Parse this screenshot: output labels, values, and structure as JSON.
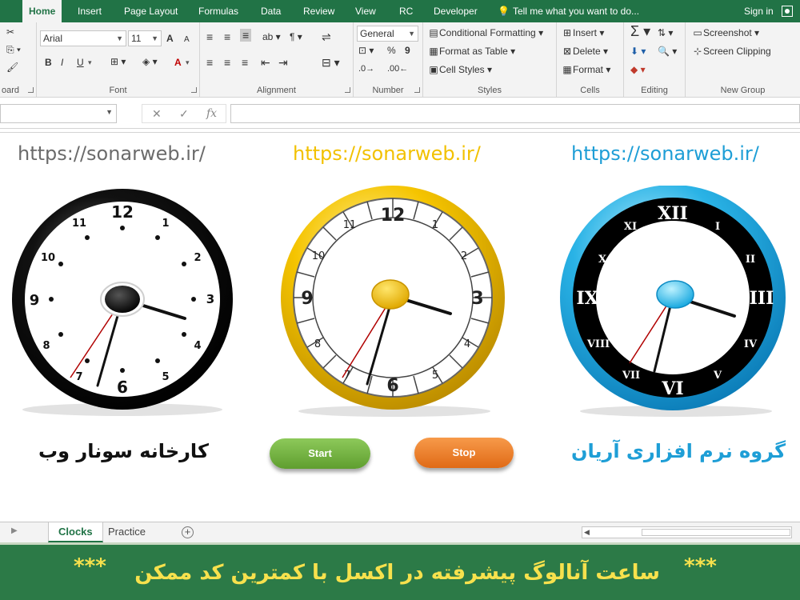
{
  "ribbon_tabs": {
    "home": "Home",
    "insert": "Insert",
    "page_layout": "Page Layout",
    "formulas": "Formulas",
    "data": "Data",
    "review": "Review",
    "view": "View",
    "rc": "RC",
    "developer": "Developer",
    "tell_me": "Tell me what you want to do...",
    "sign_in": "Sign in"
  },
  "ribbon": {
    "clipboard_label": "oard",
    "font": {
      "name": "Arial",
      "size": "11",
      "label": "Font",
      "bold": "B",
      "italic": "I",
      "underline": "U",
      "grow": "A",
      "shrink": "A",
      "font_color": "A"
    },
    "alignment_label": "Alignment",
    "number": {
      "format": "General",
      "percent": "%",
      "comma": "9",
      "label": "Number"
    },
    "styles": {
      "conditional": "Conditional Formatting",
      "table": "Format as Table",
      "cell": "Cell Styles",
      "label": "Styles"
    },
    "cells": {
      "insert": "Insert",
      "delete": "Delete",
      "format": "Format",
      "label": "Cells"
    },
    "editing_label": "Editing",
    "new_group": {
      "screenshot": "Screenshot",
      "clipping": "Screen Clipping",
      "label": "New Group"
    }
  },
  "formula_bar": {
    "name_box": "",
    "cancel": "✕",
    "enter": "✓",
    "fx": "fx",
    "formula": ""
  },
  "sheet": {
    "urls": [
      "https://sonarweb.ir/",
      "https://sonarweb.ir/",
      "https://sonarweb.ir/"
    ],
    "caption_left": "کارخانه سونار وب",
    "caption_right": "گروه نرم افزاری آریان",
    "start_button": "Start",
    "stop_button": "Stop",
    "clock_left_numbers": [
      "12",
      "1",
      "2",
      "3",
      "4",
      "5",
      "6",
      "7",
      "8",
      "9",
      "10",
      "11"
    ],
    "clock_middle_numbers": [
      "12",
      "1",
      "2",
      "3",
      "4",
      "5",
      "6",
      "7",
      "8",
      "9",
      "10",
      "11"
    ],
    "clock_right_numbers": [
      "XII",
      "I",
      "II",
      "III",
      "IV",
      "V",
      "VI",
      "VII",
      "VIII",
      "IX",
      "X",
      "XI"
    ]
  },
  "sheet_tabs": {
    "tabs": [
      "Clocks",
      "Practice"
    ],
    "active": "Clocks"
  },
  "banner": {
    "stars_left": "***",
    "stars_right": "***",
    "text": "ساعت آنالوگ پیشرفته در اکسل با کمترین کد ممکن"
  },
  "colors": {
    "excel_green": "#217346",
    "url_left": "#6b6b6b",
    "url_middle": "#f2c100",
    "url_right": "#1e9ed6",
    "banner_bg": "#2c7a47",
    "banner_text": "#f7e14d"
  }
}
